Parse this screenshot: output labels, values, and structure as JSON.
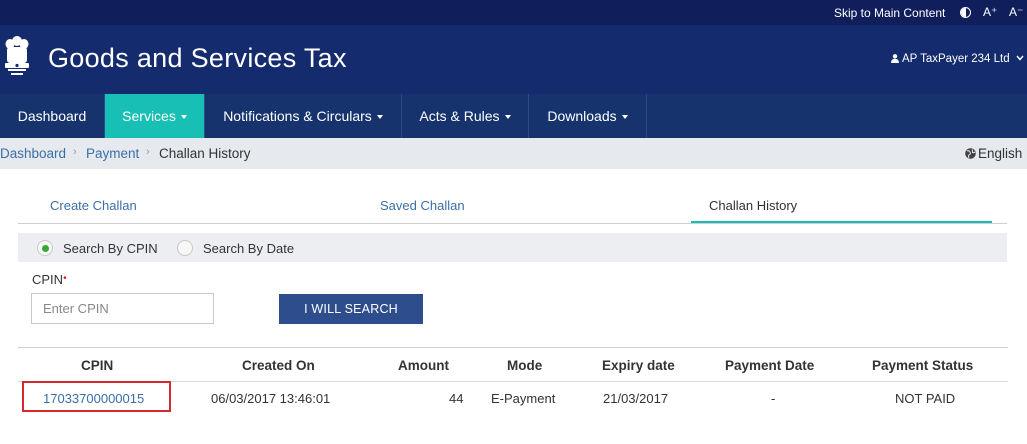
{
  "topbar": {
    "skip_link": "Skip to Main Content",
    "font_increase": "A⁺",
    "font_decrease": "A⁻"
  },
  "header": {
    "title": "Goods and Services Tax",
    "user": "AP TaxPayer 234 Ltd"
  },
  "nav": {
    "items": [
      {
        "label": "Dashboard"
      },
      {
        "label": "Services"
      },
      {
        "label": "Notifications & Circulars"
      },
      {
        "label": "Acts & Rules"
      },
      {
        "label": "Downloads"
      }
    ]
  },
  "breadcrumb": {
    "items": [
      "Dashboard",
      "Payment",
      "Challan History"
    ],
    "language": "English"
  },
  "tabs": [
    "Create Challan",
    "Saved Challan",
    "Challan History"
  ],
  "search_options": [
    "Search By CPIN",
    "Search By Date"
  ],
  "form": {
    "cpin_label": "CPIN",
    "required_mark": "•",
    "cpin_placeholder": "Enter CPIN",
    "search_button": "I WILL SEARCH"
  },
  "table": {
    "headers": [
      "CPIN",
      "Created On",
      "Amount",
      "Mode",
      "Expiry date",
      "Payment Date",
      "Payment Status"
    ],
    "rows": [
      [
        "17033700000015",
        "06/03/2017 13:46:01",
        "44",
        "E-Payment",
        "21/03/2017",
        "-",
        "NOT PAID"
      ]
    ]
  },
  "colors": {
    "top_strip": "#101f5b",
    "header": "#142b6d",
    "nav": "#16336e",
    "nav_active": "#17bfb4",
    "button": "#2e4d8c",
    "link": "#3a6fa8",
    "highlight": "#d62a2a"
  }
}
